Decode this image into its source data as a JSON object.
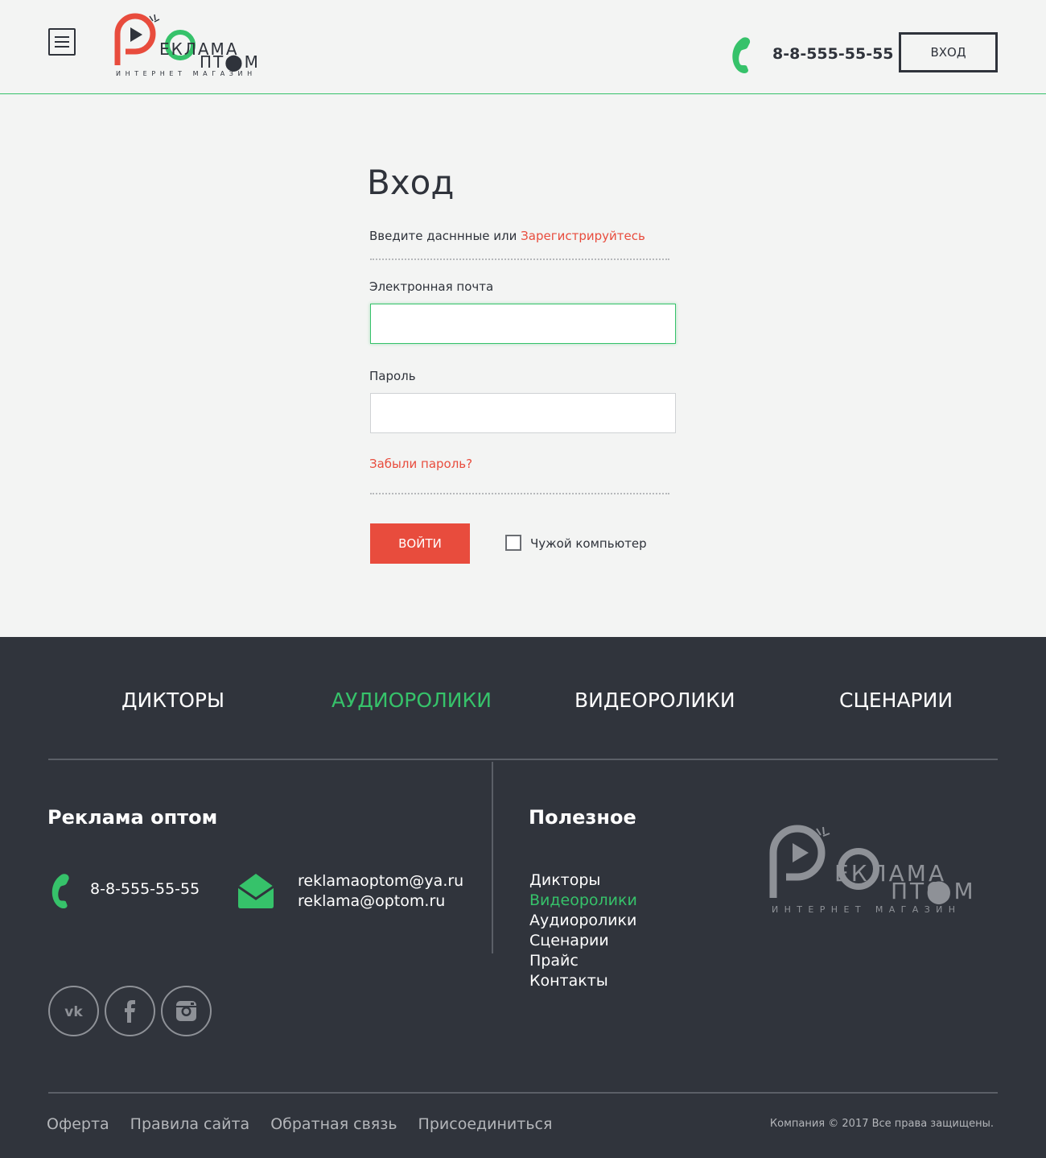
{
  "header": {
    "menu_icon": "hamburger-menu-icon",
    "logo": {
      "line1": "ЕКЛАМА",
      "line2": "ПТ⬤М",
      "line3": "ИНТЕРНЕТ МАГАЗИН"
    },
    "phone_icon": "phone-icon",
    "phone": "8-8-555-55-55",
    "login_label": "Вход"
  },
  "login": {
    "title": "Вход",
    "subtitle_prefix": "Введите дасннные или ",
    "register_link": "Зарегистрируйтесь",
    "email_label": "Электронная почта",
    "email_value": "",
    "password_label": "Пароль",
    "password_value": "",
    "forgot_link": "Забыли пароль?",
    "submit_label": "Войти",
    "foreign_pc_label": "Чужой компьютер",
    "foreign_pc_checked": false
  },
  "footer": {
    "nav": [
      {
        "label": "Дикторы",
        "active": false
      },
      {
        "label": "Аудиоролики",
        "active": true
      },
      {
        "label": "Видеоролики",
        "active": false
      },
      {
        "label": "Сценарии",
        "active": false
      }
    ],
    "contacts_heading": "Реклама оптом",
    "phone_icon": "phone-icon",
    "phone": "8-8-555-55-55",
    "mail_icon": "envelope-icon",
    "emails": [
      "reklamaoptom@ya.ru",
      "reklama@optom.ru"
    ],
    "social": [
      {
        "name": "vk",
        "icon": "vk-icon"
      },
      {
        "name": "facebook",
        "icon": "facebook-icon"
      },
      {
        "name": "instagram",
        "icon": "instagram-icon"
      }
    ],
    "useful_heading": "Полезное",
    "useful_links": [
      {
        "label": "Дикторы",
        "active": false
      },
      {
        "label": "Видеоролики",
        "active": true
      },
      {
        "label": "Аудиоролики",
        "active": false
      },
      {
        "label": "Сценарии",
        "active": false
      },
      {
        "label": "Прайс",
        "active": false
      },
      {
        "label": "Контакты",
        "active": false
      }
    ],
    "logo": {
      "line1": "ЕКЛАМА",
      "line2": "ПТ⬤М",
      "line3": "ИНТЕРНЕТ МАГАЗИН"
    },
    "bottom_links": [
      "Оферта",
      "Правила сайта",
      "Обратная связь",
      "Присоединиться"
    ],
    "copyright": "Компания © 2017  Все права защищены."
  },
  "colors": {
    "accent_green": "#36c26a",
    "accent_red": "#e84c3d",
    "dark": "#30343c",
    "text": "#2f333b",
    "background": "#f3f4f3"
  }
}
